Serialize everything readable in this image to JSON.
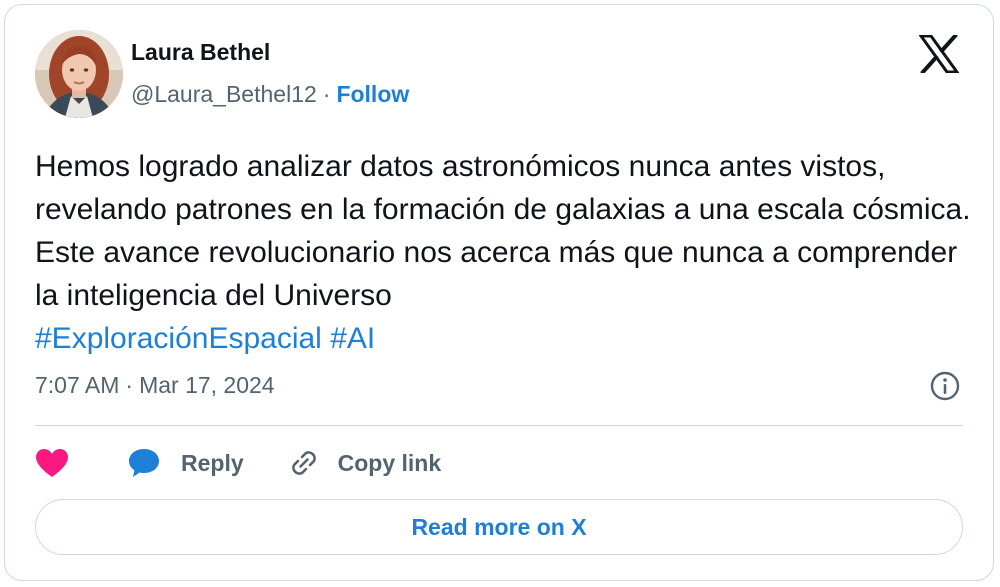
{
  "author": {
    "name": "Laura Bethel",
    "handle": "@Laura_Bethel12",
    "separator": "·",
    "follow_label": "Follow"
  },
  "tweet": {
    "text": "Hemos logrado analizar datos astronómicos nunca antes vistos, revelando patrones en la formación de galaxias a una escala cósmica. Este avance revolucionario nos acerca más que nunca a comprender la inteligencia del Universo",
    "hashtags": [
      "#ExploraciónEspacial",
      "#AI"
    ]
  },
  "meta": {
    "time": "7:07 AM",
    "separator": "·",
    "date": "Mar 17, 2024"
  },
  "actions": {
    "like_icon": "heart-icon",
    "reply_label": "Reply",
    "reply_icon": "speech-bubble-icon",
    "copy_label": "Copy link",
    "copy_icon": "link-icon"
  },
  "read_more_label": "Read more on X",
  "icons": {
    "brand": "x-logo-icon",
    "info": "info-icon"
  },
  "colors": {
    "accent": "#1d7fd6",
    "like": "#f91880",
    "secondary_text": "#536471",
    "border": "#cfd9de"
  }
}
